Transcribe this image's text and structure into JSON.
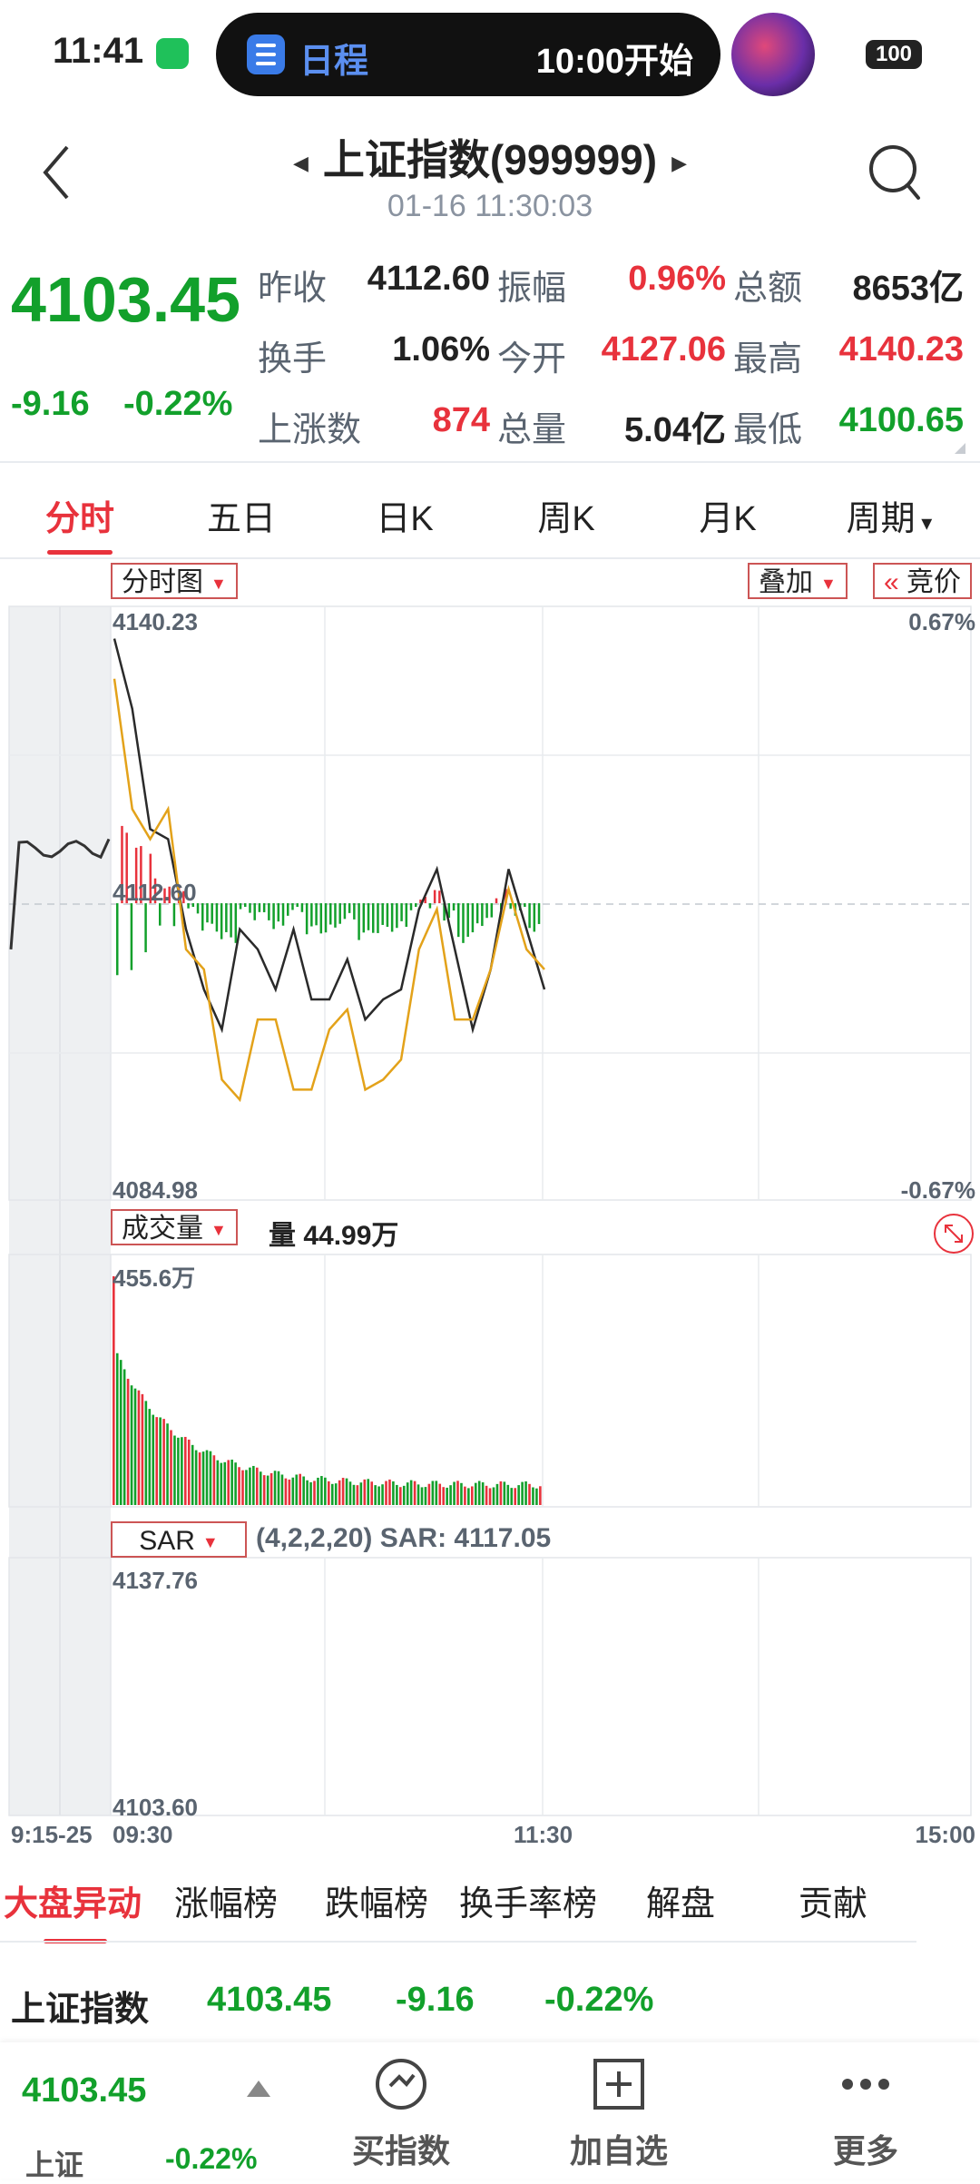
{
  "status_bar": {
    "time": "11:41",
    "pill_label": "日程",
    "pill_text": "10:00开始",
    "battery": "100"
  },
  "header": {
    "title": "上证指数(999999)",
    "subtitle": "01-16 11:30:03"
  },
  "quote": {
    "price": "4103.45",
    "change": "-9.16",
    "change_pct": "-0.22%",
    "fields": [
      {
        "label": "昨收",
        "value": "4112.60",
        "color": "#222222"
      },
      {
        "label": "振幅",
        "value": "0.96%",
        "color": "#e8323c"
      },
      {
        "label": "总额",
        "value": "8653亿",
        "color": "#222222"
      },
      {
        "label": "换手",
        "value": "1.06%",
        "color": "#222222"
      },
      {
        "label": "今开",
        "value": "4127.06",
        "color": "#e8323c"
      },
      {
        "label": "最高",
        "value": "4140.23",
        "color": "#e8323c"
      },
      {
        "label": "上涨数",
        "value": "874",
        "color": "#e8323c"
      },
      {
        "label": "总量",
        "value": "5.04亿",
        "color": "#222222"
      },
      {
        "label": "最低",
        "value": "4100.65",
        "color": "#12a02b"
      }
    ]
  },
  "tabs": [
    "分时",
    "五日",
    "日K",
    "周K",
    "月K",
    "周期"
  ],
  "chart": {
    "mode_label": "分时图",
    "overlay_label": "叠加",
    "auction_label": "竞价",
    "max_price": "4140.23",
    "prev_close": "4112.60",
    "min_price": "4084.98",
    "max_pct": "0.67%",
    "min_pct": "-0.67%",
    "volume_label": "成交量",
    "volume_text": "量 44.99万",
    "volume_max": "455.6万",
    "sar_label": "SAR",
    "sar_params": "(4,2,2,20) SAR: 4117.05",
    "sar_max": "4137.76",
    "sar_min": "4103.60",
    "time_start": "9:15-25",
    "time_open": "09:30",
    "time_mid": "11:30",
    "time_end": "15:00"
  },
  "chart_data": {
    "type": "line",
    "x": [
      "09:30",
      "09:35",
      "09:40",
      "09:45",
      "09:50",
      "09:55",
      "10:00",
      "10:05",
      "10:10",
      "10:15",
      "10:20",
      "10:25",
      "10:30",
      "10:35",
      "10:40",
      "10:45",
      "10:50",
      "10:55",
      "11:00",
      "11:05",
      "11:10",
      "11:15",
      "11:20",
      "11:25",
      "11:30"
    ],
    "series": [
      {
        "values": [
          4139,
          4132,
          4120,
          4119,
          4110,
          4104,
          4100,
          4110,
          4108,
          4104,
          4110,
          4103,
          4103,
          4107,
          4101,
          4103,
          4104,
          4112,
          4116,
          4108,
          4100,
          4106,
          4116,
          4110,
          4104
        ]
      },
      {
        "values": [
          4135,
          4122,
          4119,
          4122,
          4108,
          4106,
          4095,
          4093,
          4101,
          4101,
          4094,
          4094,
          4100,
          4102,
          4094,
          4095,
          4097,
          4108,
          4112,
          4101,
          4101,
          4106,
          4114,
          4108,
          4106
        ]
      }
    ],
    "ylim": [
      4084.98,
      4140.23
    ],
    "reference": 4112.6
  },
  "bottom_tabs": [
    "大盘异动",
    "涨幅榜",
    "跌幅榜",
    "换手率榜",
    "解盘",
    "贡献"
  ],
  "summary": {
    "name": "上证指数",
    "price": "4103.45",
    "change": "-9.16",
    "change_pct": "-0.22%"
  },
  "bottom_nav": {
    "price": "4103.45",
    "name": "上证",
    "change_pct": "-0.22%",
    "items": [
      "买指数",
      "加自选",
      "更多"
    ]
  }
}
